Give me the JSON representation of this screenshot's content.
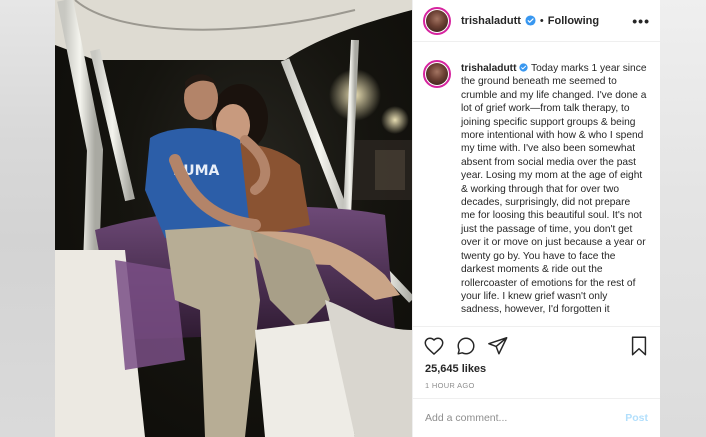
{
  "post": {
    "username": "trishaladutt",
    "separator": "•",
    "follow_status": "Following",
    "more_label": "•••",
    "caption": {
      "username": "trishaladutt",
      "text": "Today marks 1 year since the ground beneath me seemed to crumble and my life changed. I've done a lot of grief work—from talk therapy, to joining specific support groups & being more intentional with how & who I spend my time with. I've also been somewhat absent from social media over the past year. Losing my mom at the age of eight & working through that for over two decades, surprisingly, did not prepare me for loosing this beautiful soul. It's not just the passage of time, you don't get over it or move on just because a year or twenty go by. You have to face the darkest moments & ride out the rollercoaster of emotions for the rest of your life. I knew grief wasn't only sadness, however, I'd forgotten it"
    },
    "likes": "25,645 likes",
    "time": "1 HOUR AGO",
    "comment_placeholder": "Add a comment...",
    "post_label": "Post",
    "icons": [
      "heart-icon",
      "comment-icon",
      "share-icon",
      "bookmark-icon",
      "verified-badge-icon"
    ],
    "colors": {
      "accent": "#0095f6",
      "post_disabled": "#b2dffc",
      "verified": "#3897f0",
      "story_ring": "#d6249f"
    }
  },
  "photo": {
    "shirt_text": "PUMA"
  }
}
